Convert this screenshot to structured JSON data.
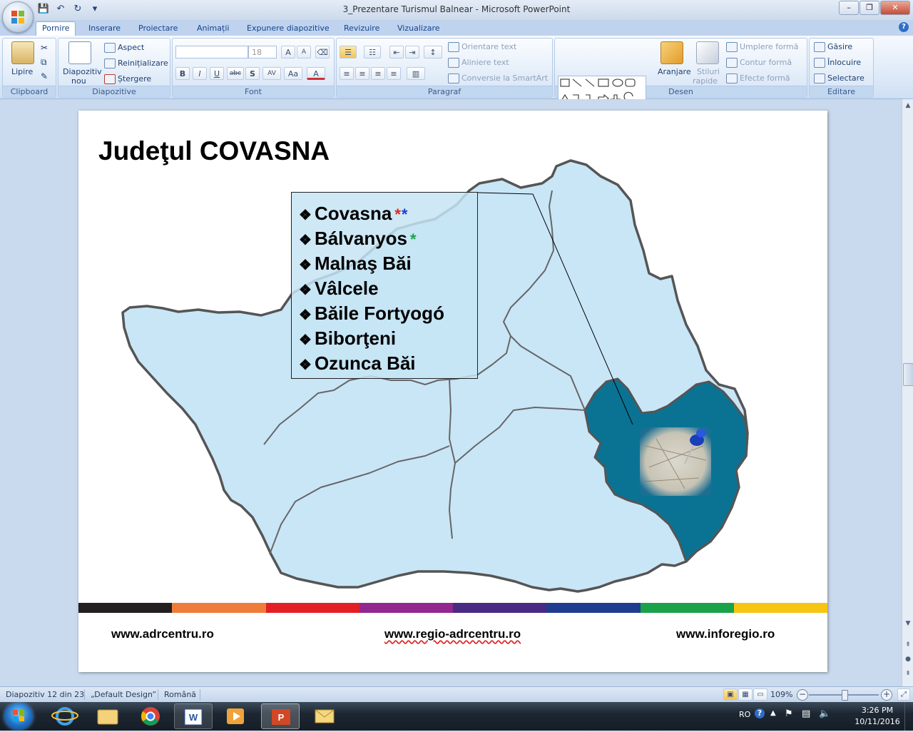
{
  "window": {
    "title": "3_Prezentare Turismul Balnear - Microsoft PowerPoint",
    "min_label": "–",
    "max_label": "❐",
    "close_label": "✕"
  },
  "qat": {
    "save_icon": "💾",
    "undo_icon": "↶",
    "redo_icon": "↻",
    "customize_icon": "▾"
  },
  "tabs": [
    "Pornire",
    "Inserare",
    "Proiectare",
    "Animații",
    "Expunere diapozitive",
    "Revizuire",
    "Vizualizare"
  ],
  "help_label": "?",
  "ribbon": {
    "clipboard": {
      "paste_label": "Lipire",
      "group_label": "Clipboard"
    },
    "slides": {
      "new_slide_line1": "Diapozitiv",
      "new_slide_line2": "nou",
      "layout": "Aspect",
      "reset": "Reinițializare",
      "delete": "Ștergere",
      "group_label": "Diapozitive"
    },
    "font": {
      "font_size": "18",
      "bold": "B",
      "italic": "I",
      "underline": "U",
      "strike": "abc",
      "shadow": "S",
      "spacing": "AV",
      "case": "Aa",
      "group_label": "Font"
    },
    "paragraph": {
      "text_direction": "Orientare text",
      "align_text": "Aliniere text",
      "smartart": "Conversie la SmartArt",
      "group_label": "Paragraf"
    },
    "drawing": {
      "arrange": "Aranjare",
      "quick_styles_line1": "Stiluri",
      "quick_styles_line2": "rapide",
      "fill": "Umplere formă",
      "outline": "Contur formă",
      "effects": "Efecte formă",
      "group_label": "Desen"
    },
    "editing": {
      "find": "Găsire",
      "replace": "Înlocuire",
      "select": "Selectare",
      "group_label": "Editare"
    }
  },
  "slide": {
    "title": "Judeţul COVASNA",
    "bullet_symbol": "❖",
    "spas": [
      {
        "name": "Covasna",
        "marks": [
          {
            "symbol": "*",
            "color": "#e8241b"
          },
          {
            "symbol": "*",
            "color": "#1f3fd6"
          }
        ]
      },
      {
        "name": "Bálvanyos",
        "marks": [
          {
            "symbol": "*",
            "color": "#1fa049"
          }
        ]
      },
      {
        "name": "Malnaş Băi",
        "marks": []
      },
      {
        "name": "Vâlcele",
        "marks": []
      },
      {
        "name": "Băile Fortyogó",
        "marks": []
      },
      {
        "name": "Biborţeni",
        "marks": []
      },
      {
        "name": "Ozunca Băi",
        "marks": []
      }
    ],
    "colorbar": [
      "#231f20",
      "#ef7d3a",
      "#e31f26",
      "#92278f",
      "#4a2a82",
      "#1f3c8f",
      "#1aa24a",
      "#f7c412"
    ],
    "links": [
      "www.adrcentru.ro",
      "www.regio-adrcentru.ro",
      "www.inforegio.ro"
    ]
  },
  "status": {
    "slide_info": "Diapozitiv 12 din 23",
    "theme": "„Default Design”",
    "language": "Română",
    "zoom": "109%"
  },
  "taskbar": {
    "lang": "RO",
    "time": "3:26 PM",
    "date": "10/11/2016"
  }
}
